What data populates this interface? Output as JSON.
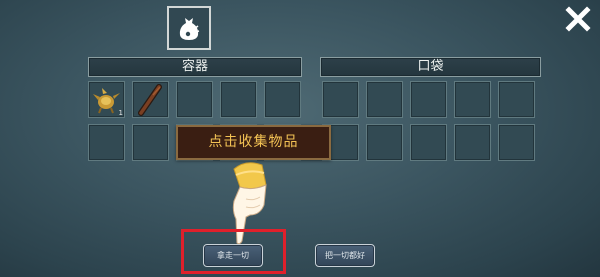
{
  "header": {
    "bag_icon": "loot-bag-icon",
    "close_icon": "close-icon"
  },
  "container": {
    "title": "容器",
    "slots": [
      {
        "item": "golden-plant-icon",
        "count": "1"
      },
      {
        "item": "wooden-club-icon",
        "count": ""
      },
      {
        "item": "",
        "count": ""
      },
      {
        "item": "",
        "count": ""
      },
      {
        "item": "",
        "count": ""
      },
      {
        "item": "",
        "count": ""
      },
      {
        "item": "",
        "count": ""
      },
      {
        "item": "",
        "count": ""
      },
      {
        "item": "",
        "count": ""
      },
      {
        "item": "",
        "count": ""
      }
    ]
  },
  "pocket": {
    "title": "口袋",
    "slot_count": 10
  },
  "tooltip": {
    "text": "点击收集物品"
  },
  "buttons": {
    "take_all": "拿走一切",
    "drop_all": "把一切都好"
  },
  "tutorial": {
    "pointer_icon": "tutorial-hand-pointer-icon",
    "highlight_color": "#e0202b"
  },
  "colors": {
    "tooltip_text": "#f3c254",
    "tooltip_bg": "#3a1e12"
  }
}
